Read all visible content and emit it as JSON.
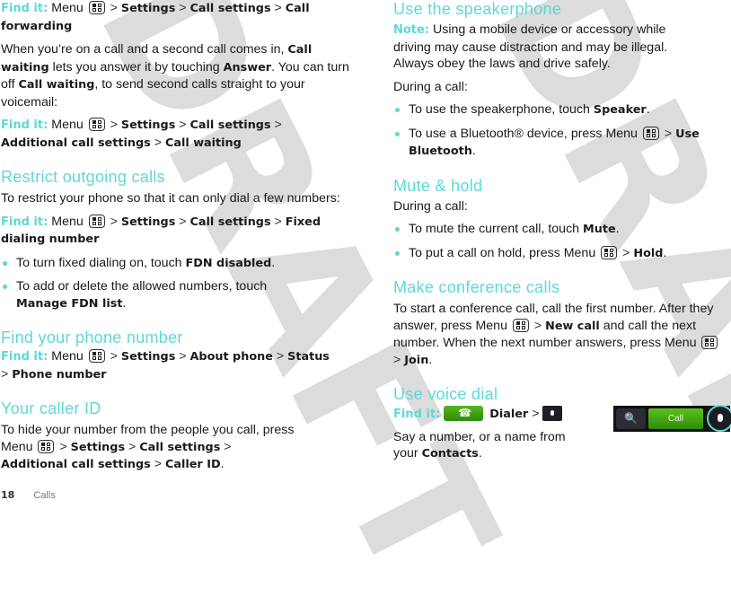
{
  "watermark": {
    "left": "DRAFT",
    "right": "DRAFT"
  },
  "colors": {
    "accent": "#5ed8d6",
    "text": "#1a1a1a"
  },
  "left": {
    "s1": {
      "find": "Find it:",
      "menu": "Menu",
      "sep": ">",
      "p1": "Settings",
      "p2": "Call settings",
      "p3": "Call forwarding"
    },
    "s2": {
      "t1": "When you’re on a call and a second call comes in,",
      "b1": "Call waiting",
      "t2": "lets you answer it by touching",
      "b2": "Answer",
      "t3": ". You can turn off",
      "b3": "Call waiting",
      "t4": ", to send second calls straight to your voicemail:"
    },
    "s3": {
      "find": "Find it:",
      "menu": "Menu",
      "p1": "Settings",
      "p2": "Call settings",
      "p3": "Additional call settings",
      "p4": "Call waiting"
    },
    "restrict": {
      "heading": "Restrict outgoing calls",
      "intro": "To restrict your phone so that it can only dial a few numbers:",
      "find": "Find it:",
      "menu": "Menu",
      "p1": "Settings",
      "p2": "Call settings",
      "p3": "Fixed dialing number",
      "bullets": [
        {
          "text": "To turn fixed dialing on, touch",
          "bold": "FDN disabled",
          "end": "."
        },
        {
          "text": "To add or delete the allowed numbers, touch",
          "bold": "Manage FDN list",
          "end": "."
        }
      ]
    },
    "phone_number": {
      "heading": "Find your phone number",
      "find": "Find it:",
      "menu": "Menu",
      "p1": "Settings",
      "p2": "About phone",
      "p3": "Status",
      "p4": "Phone number"
    },
    "caller_id": {
      "heading": "Your caller ID",
      "t1": "To hide your number from the people you call, press Menu",
      "p1": "Settings",
      "p2": "Call settings",
      "p3": "Additional call settings",
      "p4": "Caller ID",
      "end": "."
    }
  },
  "right": {
    "speaker": {
      "heading": "Use the speakerphone",
      "note_label": "Note:",
      "note": "Using a mobile device or accessory while driving may cause distraction and may be illegal. Always obey the laws and drive safely.",
      "during": "During a call:",
      "bullets": [
        {
          "text": "To use the speakerphone, touch",
          "bold": "Speaker",
          "end": "."
        },
        {
          "text": "To use a Bluetooth® device, press Menu",
          "bold": "Use Bluetooth",
          "end": "."
        }
      ]
    },
    "mute": {
      "heading": "Mute & hold",
      "during": "During a call:",
      "bullets": [
        {
          "text": "To mute the current call, touch",
          "bold": "Mute",
          "end": "."
        },
        {
          "text": "To put a call on hold, press Menu",
          "bold": "Hold",
          "end": "."
        }
      ]
    },
    "conference": {
      "heading": "Make conference calls",
      "t1": "To start a conference call, call the first number. After they answer, press Menu",
      "b1": "New call",
      "t2": "and call the next number. When the next number answers, press Menu",
      "b2": "Join",
      "end": "."
    },
    "voice": {
      "heading": "Use voice dial",
      "find": "Find it:",
      "dialer": "Dialer",
      "say": "Say a number, or a name from your",
      "contacts": "Contacts",
      "end": "."
    },
    "dialbar": {
      "call_label": "Call"
    }
  },
  "footer": {
    "page": "18",
    "section": "Calls"
  }
}
